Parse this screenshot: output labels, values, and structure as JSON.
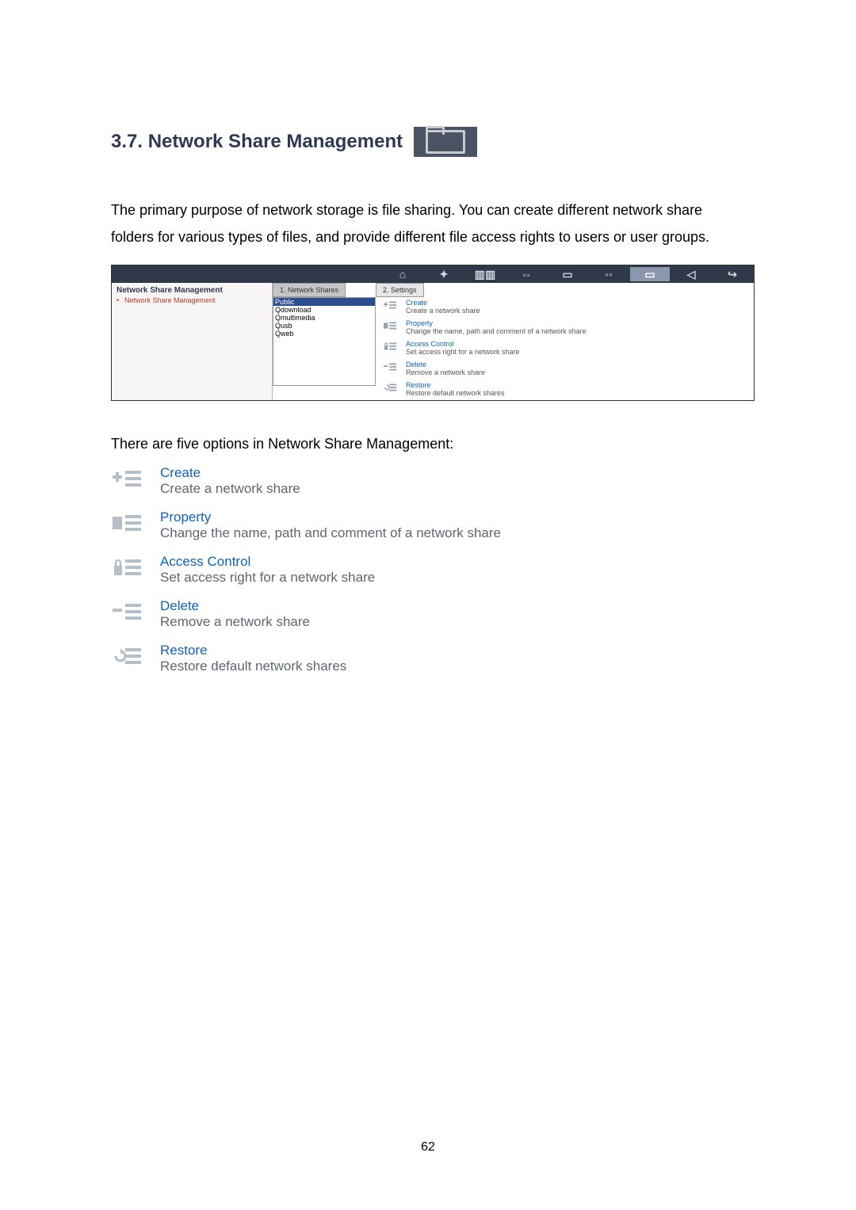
{
  "heading": {
    "number_title": "3.7.  Network Share Management"
  },
  "intro": "The primary purpose of network storage is file sharing.  You can create different network share folders for various types of files, and provide different file access rights to users or user groups.",
  "screenshot": {
    "topbar_icons": [
      "home",
      "quick",
      "server",
      "network",
      "disk",
      "users",
      "folder",
      "tools",
      "logout"
    ],
    "sidebar": {
      "title": "Network Share Management",
      "link": "Network Share Management"
    },
    "tabs": [
      "1. Network Shares",
      "2. Settings"
    ],
    "shares": [
      "Public",
      "Qdownload",
      "Qmultimedia",
      "Qusb",
      "Qweb"
    ],
    "actions": [
      {
        "title": "Create",
        "desc": "Create a network share",
        "icon": "plus"
      },
      {
        "title": "Property",
        "desc": "Change the name, path and comment of a network share",
        "icon": "prop"
      },
      {
        "title": "Access Control",
        "desc": "Set access right for a network share",
        "icon": "lock"
      },
      {
        "title": "Delete",
        "desc": "Remove a network share",
        "icon": "minus"
      },
      {
        "title": "Restore",
        "desc": "Restore default network shares",
        "icon": "restore"
      }
    ]
  },
  "options_lead": "There are five options in Network Share Management:",
  "options": [
    {
      "title": "Create",
      "desc": "Create a network share",
      "icon": "plus"
    },
    {
      "title": "Property",
      "desc": "Change the name, path and comment of a network share",
      "icon": "prop"
    },
    {
      "title": "Access Control",
      "desc": "Set access right for a network share",
      "icon": "lock"
    },
    {
      "title": "Delete",
      "desc": "Remove a network share",
      "icon": "minus"
    },
    {
      "title": "Restore",
      "desc": "Restore default network shares",
      "icon": "restore"
    }
  ],
  "page_number": "62"
}
